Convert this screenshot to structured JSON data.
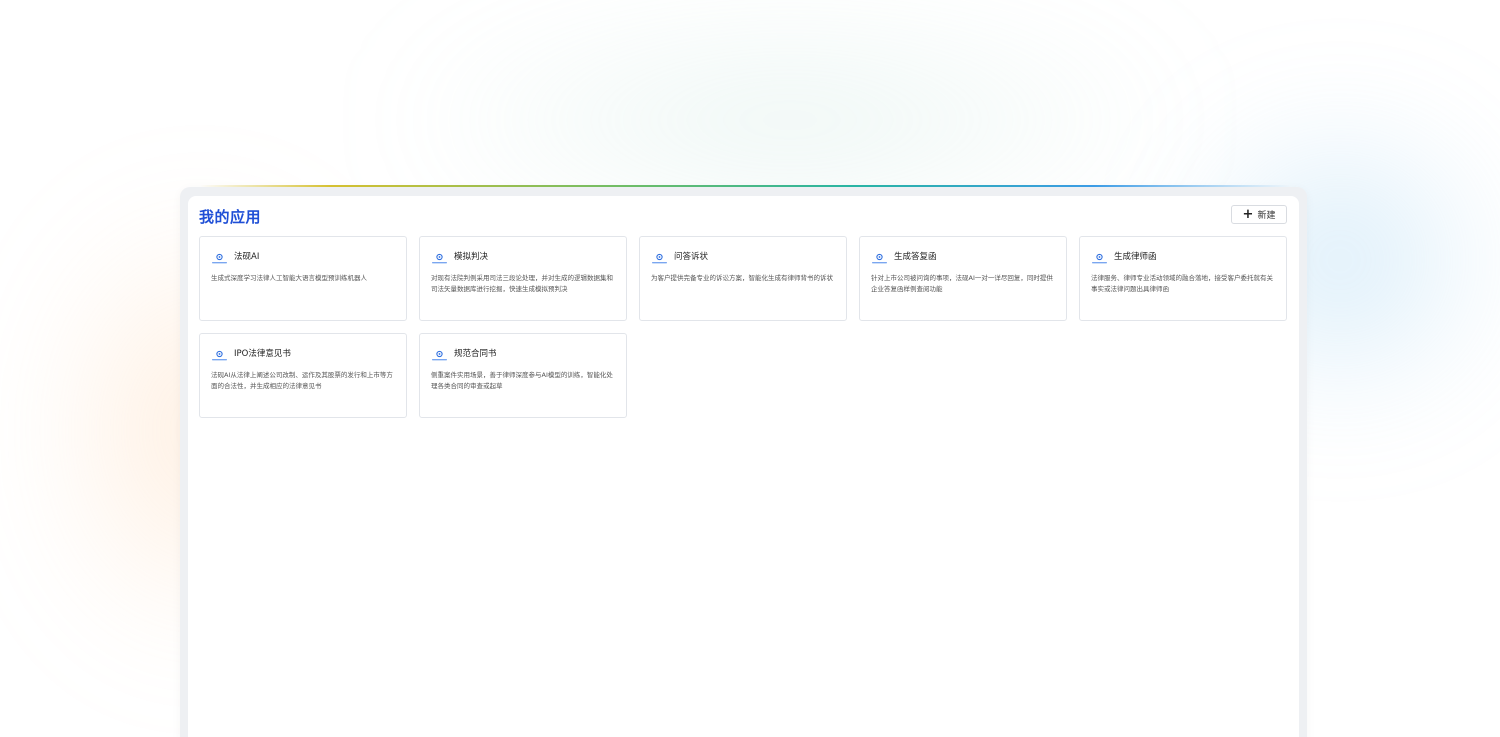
{
  "page": {
    "title": "我的应用",
    "new_button_label": "新建"
  },
  "apps": [
    {
      "title": "法砚AI",
      "description": "生成式深度学习法律人工智能大语言模型预训练机器人",
      "icon": "app-logo-icon"
    },
    {
      "title": "模拟判决",
      "description": "对现有法院判例采用司法三段论处理，并对生成的逻辑数据集和司法矢量数据库进行挖掘，快速生成模拟预判决",
      "icon": "app-logo-icon"
    },
    {
      "title": "问答诉状",
      "description": "为客户提供完备专业的诉讼方案，智能化生成有律师背书的诉状",
      "icon": "app-logo-icon"
    },
    {
      "title": "生成答复函",
      "description": "针对上市公司被问询的事项，法砚AI一对一详尽回复，同时提供企业答复函样例查阅功能",
      "icon": "app-logo-icon"
    },
    {
      "title": "生成律师函",
      "description": "法律服务、律师专业活动领域的融合落地，接受客户委托就有关事实或法律问题出具律师函",
      "icon": "app-logo-icon"
    },
    {
      "title": "IPO法律意见书",
      "description": "法砚AI从法律上阐述公司改制、运作及其股票的发行和上市等方面的合法性，并生成相应的法律意见书",
      "icon": "app-logo-icon"
    },
    {
      "title": "规范合同书",
      "description": "侧重案件实用场景，善于律师深度参与AI模型的训练，智能化处理各类合同的审查或起草",
      "icon": "app-logo-icon"
    }
  ]
}
